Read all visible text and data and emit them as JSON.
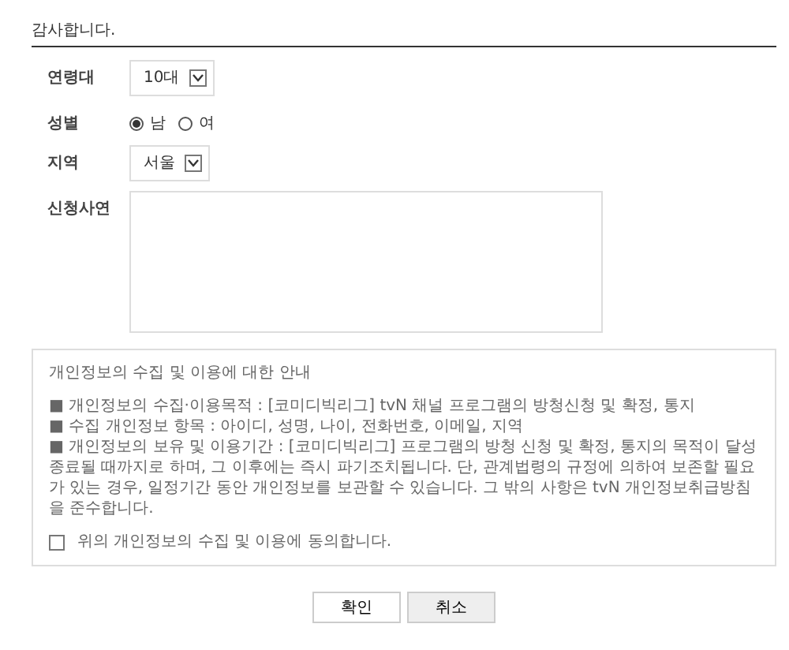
{
  "heading": "감사합니다.",
  "fields": [
    {
      "kind": "select",
      "label": "연령대",
      "value": "10대"
    },
    {
      "kind": "radio",
      "label": "성별",
      "options": [
        {
          "label": "남",
          "selected": true
        },
        {
          "label": "여",
          "selected": false
        }
      ]
    },
    {
      "kind": "select",
      "label": "지역",
      "value": "서울"
    },
    {
      "kind": "textarea",
      "label": "신청사연"
    }
  ],
  "notice": {
    "title": "개인정보의 수집 및 이용에 대한 안내",
    "items": [
      "■ 개인정보의 수집·이용목적 : [코미디빅리그] tvN 채널 프로그램의 방청신청 및 확정, 통지",
      "■ 수집 개인정보 항목 : 아이디, 성명, 나이, 전화번호, 이메일, 지역",
      "■ 개인정보의 보유 및 이용기간 : [코미디빅리그] 프로그램의 방청 신청 및 확정, 통지의 목적이 달성 종료될 때까지로 하며, 그 이후에는 즉시 파기조치됩니다. 단, 관계법령의 규정에 의하여 보존할 필요가 있는 경우, 일정기간 동안 개인정보를 보관할 수 있습니다. 그 밖의 사항은 tvN 개인정보취급방침을 준수합니다."
    ],
    "agree": {
      "label": "위의 개인정보의 수집 및 이용에 동의합니다.",
      "checked": false
    }
  },
  "buttons": [
    {
      "label": "확인",
      "kind": "primary"
    },
    {
      "label": "취소",
      "kind": "secondary"
    }
  ]
}
